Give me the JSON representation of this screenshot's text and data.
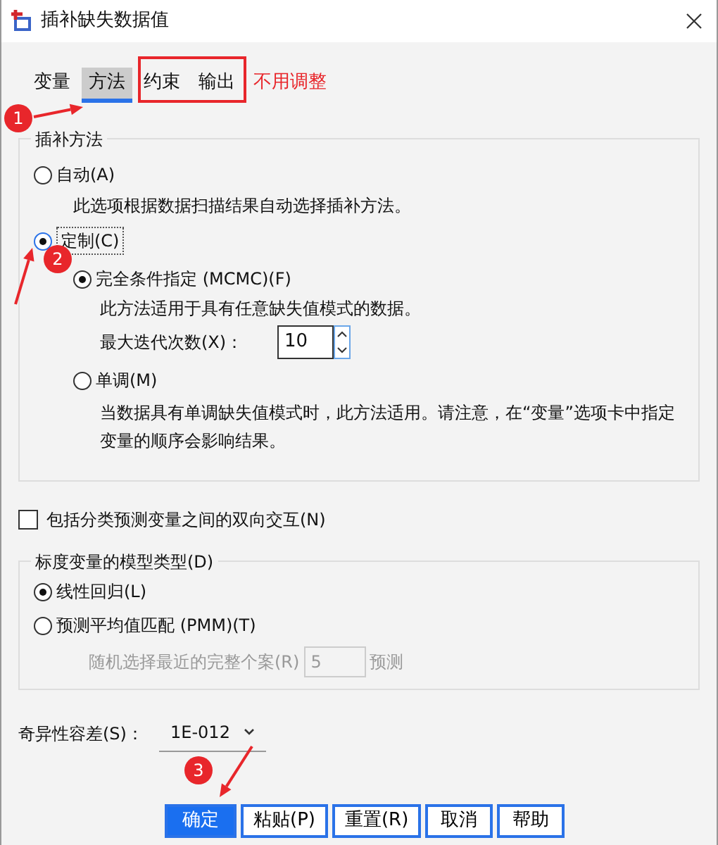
{
  "window": {
    "title": "插补缺失数据值"
  },
  "tabs": [
    {
      "label": "变量",
      "selected": false
    },
    {
      "label": "方法",
      "selected": true
    },
    {
      "label": "约束",
      "selected": false
    },
    {
      "label": "输出",
      "selected": false
    }
  ],
  "method_group": {
    "legend": "插补方法",
    "options": [
      {
        "label": "自动(A)",
        "selected": false,
        "description": "此选项根据数据扫描结果自动选择插补方法。"
      },
      {
        "label": "定制(C)",
        "selected": true
      }
    ],
    "custom_options": [
      {
        "label": "完全条件指定 (MCMC)(F)",
        "selected": true,
        "description": "此方法适用于具有任意缺失值模式的数据。",
        "field_label": "最大迭代次数(X)：",
        "field_value": "10"
      },
      {
        "label": "单调(M)",
        "selected": false,
        "description": "当数据具有单调缺失值模式时，此方法适用。请注意，在“变量”选项卡中指定变量的顺序会影响结果。"
      }
    ]
  },
  "interaction_checkbox": {
    "label": "包括分类预测变量之间的双向交互(N)",
    "checked": false
  },
  "model_group": {
    "legend": "标度变量的模型类型(D)",
    "options": [
      {
        "label": "线性回归(L)",
        "selected": true
      },
      {
        "label": "预测平均值匹配 (PMM)(T)",
        "selected": false
      }
    ],
    "pmm_field": {
      "label": "随机选择最近的完整个案(R)",
      "value": "5",
      "suffix": "预测",
      "disabled": true
    }
  },
  "tolerance": {
    "label": "奇异性容差(S)：",
    "value": "1E-012"
  },
  "buttons": [
    {
      "label": "确定",
      "primary": true
    },
    {
      "label": "粘贴(P)",
      "primary": false
    },
    {
      "label": "重置(R)",
      "primary": false
    },
    {
      "label": "取消",
      "primary": false
    },
    {
      "label": "帮助",
      "primary": false
    }
  ],
  "annotations": {
    "note": "不用调整",
    "markers": [
      "1",
      "2",
      "3"
    ]
  }
}
